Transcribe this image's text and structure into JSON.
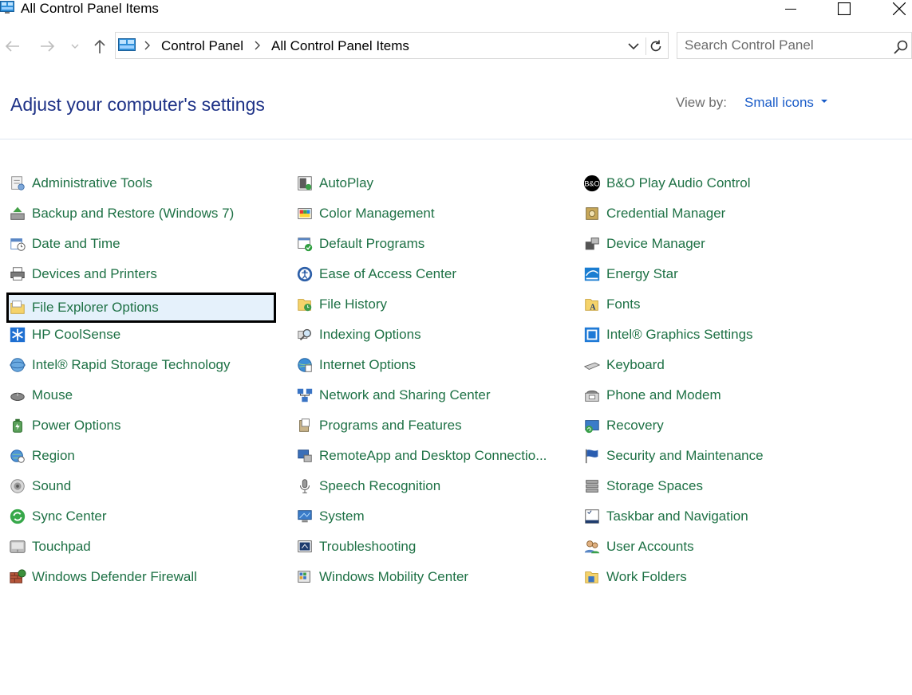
{
  "window": {
    "title": "All Control Panel Items"
  },
  "address": {
    "crumbs": [
      "Control Panel",
      "All Control Panel Items"
    ]
  },
  "search": {
    "placeholder": "Search Control Panel"
  },
  "header": {
    "title": "Adjust your computer's settings",
    "view_by_label": "View by:",
    "view_by_value": "Small icons"
  },
  "colors": {
    "heading": "#1e3287",
    "link": "#1e7145",
    "accent": "#1a5cc8",
    "selection_fill": "#e5f1fb"
  },
  "items": [
    {
      "label": "Administrative Tools",
      "icon": "admin-tools-icon"
    },
    {
      "label": "Backup and Restore (Windows 7)",
      "icon": "backup-icon"
    },
    {
      "label": "Date and Time",
      "icon": "calendar-clock-icon"
    },
    {
      "label": "Devices and Printers",
      "icon": "printer-icon"
    },
    {
      "label": "File Explorer Options",
      "icon": "folder-options-icon",
      "selected": true
    },
    {
      "label": "HP CoolSense",
      "icon": "snowflake-icon"
    },
    {
      "label": "Intel® Rapid Storage Technology",
      "icon": "storage-tech-icon"
    },
    {
      "label": "Mouse",
      "icon": "mouse-icon"
    },
    {
      "label": "Power Options",
      "icon": "battery-icon"
    },
    {
      "label": "Region",
      "icon": "globe-clock-icon"
    },
    {
      "label": "Sound",
      "icon": "speaker-icon"
    },
    {
      "label": "Sync Center",
      "icon": "sync-icon"
    },
    {
      "label": "Touchpad",
      "icon": "touchpad-icon"
    },
    {
      "label": "Windows Defender Firewall",
      "icon": "firewall-icon"
    },
    {
      "label": "AutoPlay",
      "icon": "autoplay-icon"
    },
    {
      "label": "Color Management",
      "icon": "color-management-icon"
    },
    {
      "label": "Default Programs",
      "icon": "default-programs-icon"
    },
    {
      "label": "Ease of Access Center",
      "icon": "ease-of-access-icon"
    },
    {
      "label": "File History",
      "icon": "file-history-icon"
    },
    {
      "label": "Indexing Options",
      "icon": "magnifier-icon"
    },
    {
      "label": "Internet Options",
      "icon": "internet-globe-icon"
    },
    {
      "label": "Network and Sharing Center",
      "icon": "network-icon"
    },
    {
      "label": "Programs and Features",
      "icon": "programs-box-icon"
    },
    {
      "label": "RemoteApp and Desktop Connectio...",
      "icon": "remote-desktop-icon"
    },
    {
      "label": "Speech Recognition",
      "icon": "microphone-icon"
    },
    {
      "label": "System",
      "icon": "system-monitor-icon"
    },
    {
      "label": "Troubleshooting",
      "icon": "troubleshoot-icon"
    },
    {
      "label": "Windows Mobility Center",
      "icon": "mobility-center-icon"
    },
    {
      "label": "B&O Play Audio Control",
      "icon": "bo-logo-icon"
    },
    {
      "label": "Credential Manager",
      "icon": "credential-vault-icon"
    },
    {
      "label": "Device Manager",
      "icon": "device-manager-icon"
    },
    {
      "label": "Energy Star",
      "icon": "energy-star-icon"
    },
    {
      "label": "Fonts",
      "icon": "fonts-folder-icon"
    },
    {
      "label": "Intel® Graphics Settings",
      "icon": "intel-graphics-icon"
    },
    {
      "label": "Keyboard",
      "icon": "keyboard-icon"
    },
    {
      "label": "Phone and Modem",
      "icon": "phone-modem-icon"
    },
    {
      "label": "Recovery",
      "icon": "recovery-icon"
    },
    {
      "label": "Security and Maintenance",
      "icon": "flag-icon"
    },
    {
      "label": "Storage Spaces",
      "icon": "storage-spaces-icon"
    },
    {
      "label": "Taskbar and Navigation",
      "icon": "taskbar-icon"
    },
    {
      "label": "User Accounts",
      "icon": "users-icon"
    },
    {
      "label": "Work Folders",
      "icon": "work-folders-icon"
    }
  ]
}
